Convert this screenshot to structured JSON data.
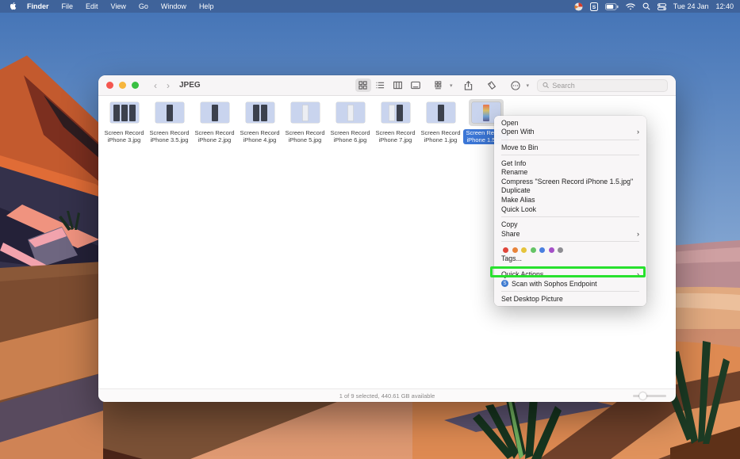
{
  "menu_bar": {
    "items": [
      "Finder",
      "File",
      "Edit",
      "View",
      "Go",
      "Window",
      "Help"
    ],
    "status": {
      "icons": [
        "app-circle-icon",
        "sophos-shield-icon",
        "battery-icon",
        "wifi-icon",
        "spotlight-search-icon",
        "control-center-icon"
      ],
      "date": "Tue 24 Jan",
      "time": "12:40"
    }
  },
  "window": {
    "title": "JPEG",
    "toolbar": {
      "view_icons": [
        "icon-view",
        "list-view",
        "column-view",
        "gallery-view"
      ],
      "action_icons": [
        "group-by-icon",
        "share-icon",
        "tags-icon",
        "more-actions-icon"
      ],
      "search_placeholder": "Search"
    },
    "files": [
      {
        "name": "Screen Record iPhone 3.jpg",
        "selected": false,
        "phones": [
          "dark",
          "dark",
          "dark"
        ]
      },
      {
        "name": "Screen Record iPhone 3.5.jpg",
        "selected": false,
        "phones": [
          "dark"
        ]
      },
      {
        "name": "Screen Record iPhone 2.jpg",
        "selected": false,
        "phones": [
          "dark"
        ]
      },
      {
        "name": "Screen Record iPhone 4.jpg",
        "selected": false,
        "phones": [
          "dark",
          "dark"
        ]
      },
      {
        "name": "Screen Record iPhone 5.jpg",
        "selected": false,
        "phones": [
          "light"
        ]
      },
      {
        "name": "Screen Record iPhone 6.jpg",
        "selected": false,
        "phones": [
          "light"
        ]
      },
      {
        "name": "Screen Record iPhone 7.jpg",
        "selected": false,
        "phones": [
          "light",
          "dark"
        ]
      },
      {
        "name": "Screen Record iPhone 1.jpg",
        "selected": false,
        "phones": [
          "dark"
        ]
      },
      {
        "name": "Screen Record iPhone 1.5.jpg",
        "selected": true,
        "phones": [
          "color"
        ]
      }
    ],
    "status_bar": {
      "text": "1 of 9 selected, 440.61 GB available"
    }
  },
  "context_menu": {
    "sections": [
      {
        "items": [
          {
            "label": "Open"
          },
          {
            "label": "Open With",
            "submenu": true
          }
        ]
      },
      {
        "items": [
          {
            "label": "Move to Bin"
          }
        ]
      },
      {
        "items": [
          {
            "label": "Get Info"
          },
          {
            "label": "Rename"
          },
          {
            "label": "Compress \"Screen Record iPhone 1.5.jpg\""
          },
          {
            "label": "Duplicate"
          },
          {
            "label": "Make Alias"
          },
          {
            "label": "Quick Look"
          }
        ]
      },
      {
        "items": [
          {
            "label": "Copy"
          },
          {
            "label": "Share",
            "submenu": true
          }
        ]
      },
      {
        "tags": [
          "#e0453a",
          "#e8833a",
          "#e5c43c",
          "#65c466",
          "#4a7fe0",
          "#a550c8",
          "#8e8e93"
        ],
        "items": [
          {
            "label": "Tags..."
          }
        ]
      },
      {
        "items": [
          {
            "label": "Quick Actions",
            "submenu": true,
            "highlighted": true
          },
          {
            "label": "Scan with Sophos Endpoint",
            "icon": "sophos-shield"
          }
        ]
      },
      {
        "items": [
          {
            "label": "Set Desktop Picture"
          }
        ]
      }
    ]
  },
  "annotation": {
    "highlight_color": "#28e12e"
  },
  "theme": {
    "selection_blue": "#3b76d6",
    "menubar_blue": "#3f6298"
  }
}
